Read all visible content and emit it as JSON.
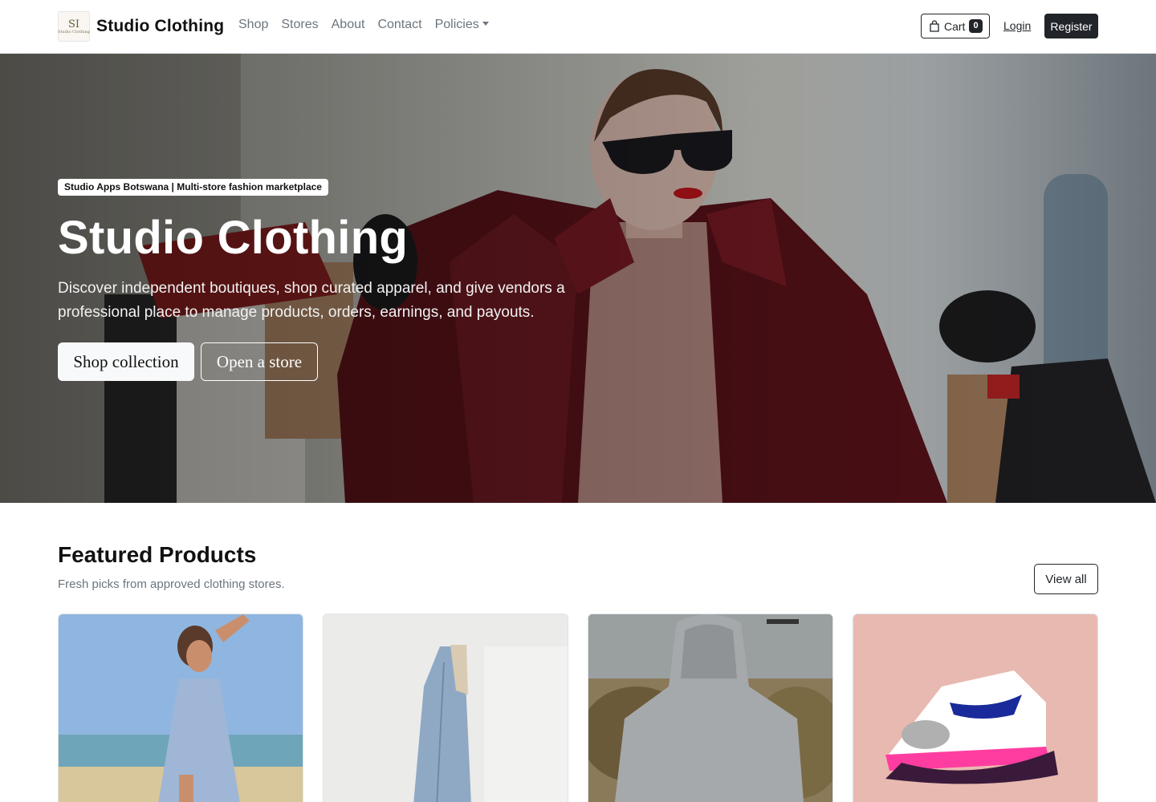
{
  "nav": {
    "brand": "Studio Clothing",
    "logo_text": "SI",
    "logo_caption": "Studio Clothing",
    "links": [
      "Shop",
      "Stores",
      "About",
      "Contact",
      "Policies"
    ],
    "cart_label": "Cart",
    "cart_count": "0",
    "login": "Login",
    "register": "Register",
    "icons": {
      "cart": "shopping-bag-icon",
      "dropdown": "chevron-down-icon"
    }
  },
  "hero": {
    "tag": "Studio Apps Botswana | Multi-store fashion marketplace",
    "title": "Studio Clothing",
    "subtitle": "Discover independent boutiques, shop curated apparel, and give vendors a professional place to manage products, orders, earnings, and payouts.",
    "primary_cta": "Shop collection",
    "secondary_cta": "Open a store"
  },
  "featured": {
    "title": "Featured Products",
    "subtitle": "Fresh picks from approved clothing stores.",
    "view_all": "View all",
    "products": [
      {
        "image": "woman in light blue dress on beach"
      },
      {
        "image": "denim jacket hanging on white wall"
      },
      {
        "image": "person in grey hoodie outdoors"
      },
      {
        "image": "white and pink sneaker on hand"
      }
    ]
  },
  "colors": {
    "dark": "#212529",
    "muted": "#6c757d",
    "border": "#dee2e6"
  }
}
